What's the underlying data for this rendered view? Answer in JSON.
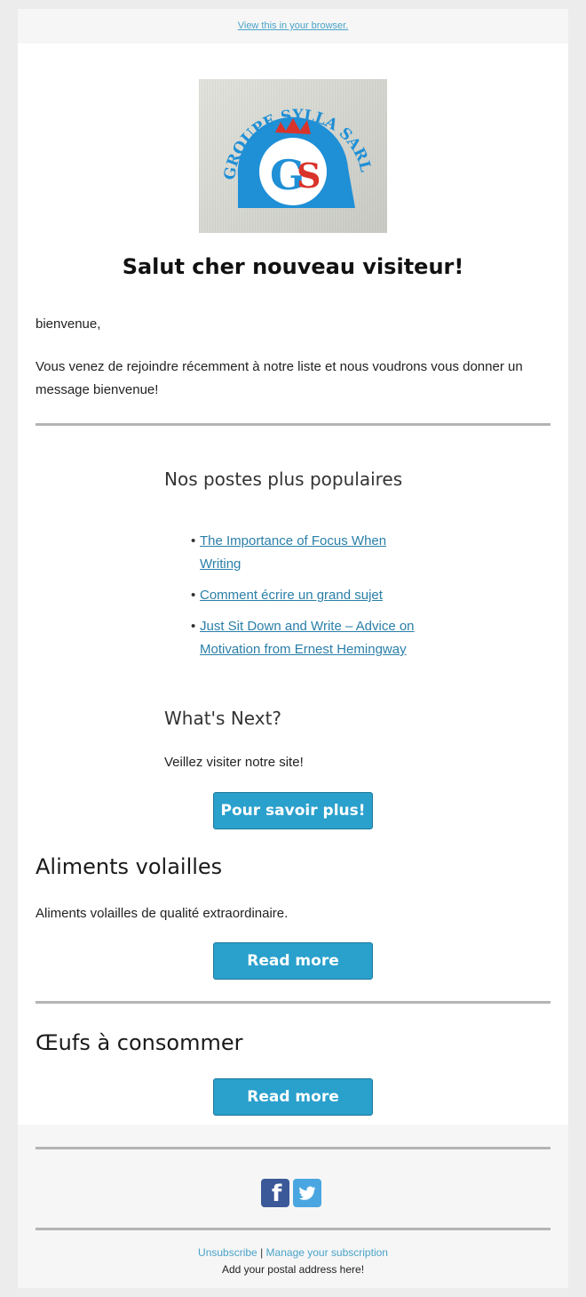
{
  "preheader": {
    "view_in_browser": "View this in your browser."
  },
  "logo": {
    "name": "groupe-sylla-logo",
    "text_arc": "GROUPE SYLLA SARL",
    "initials": "GS",
    "colors": {
      "blue": "#1f8fd6",
      "red": "#d9342b"
    }
  },
  "header": {
    "title": "Salut cher nouveau visiteur!"
  },
  "intro": {
    "greeting": "bienvenue,",
    "message": "Vous venez de rejoindre récemment à notre liste et nous voudrons vous donner un message bienvenue!"
  },
  "popular": {
    "heading": "Nos postes plus populaires",
    "posts": [
      {
        "bullet": "•",
        "title": "The Importance of Focus When Writing"
      },
      {
        "bullet": "•",
        "title": "Comment écrire un grand sujet"
      },
      {
        "bullet": "•",
        "title": "Just Sit Down and Write – Advice on Motivation from Ernest Hemingway"
      }
    ]
  },
  "next": {
    "heading": "What's Next?",
    "text": "Veillez visiter notre site!",
    "button": "Pour savoir plus!"
  },
  "section_feed": {
    "heading": "Aliments volailles",
    "text": "Aliments volailles de qualité extraordinaire.",
    "button": "Read more"
  },
  "section_eggs": {
    "heading": "Œufs à consommer",
    "button": "Read more"
  },
  "footer": {
    "social": [
      "facebook-icon",
      "twitter-icon"
    ],
    "unsubscribe": "Unsubscribe",
    "separator": "|",
    "manage": "Manage your subscription",
    "address": "Add your postal address here!"
  },
  "colors": {
    "button": "#2aa0cc",
    "link": "#2a7fa8",
    "footer_link": "#4aa3c8",
    "rule": "#b4b4b4",
    "page_bg": "#ececec",
    "footer_bg": "#f6f6f6"
  }
}
